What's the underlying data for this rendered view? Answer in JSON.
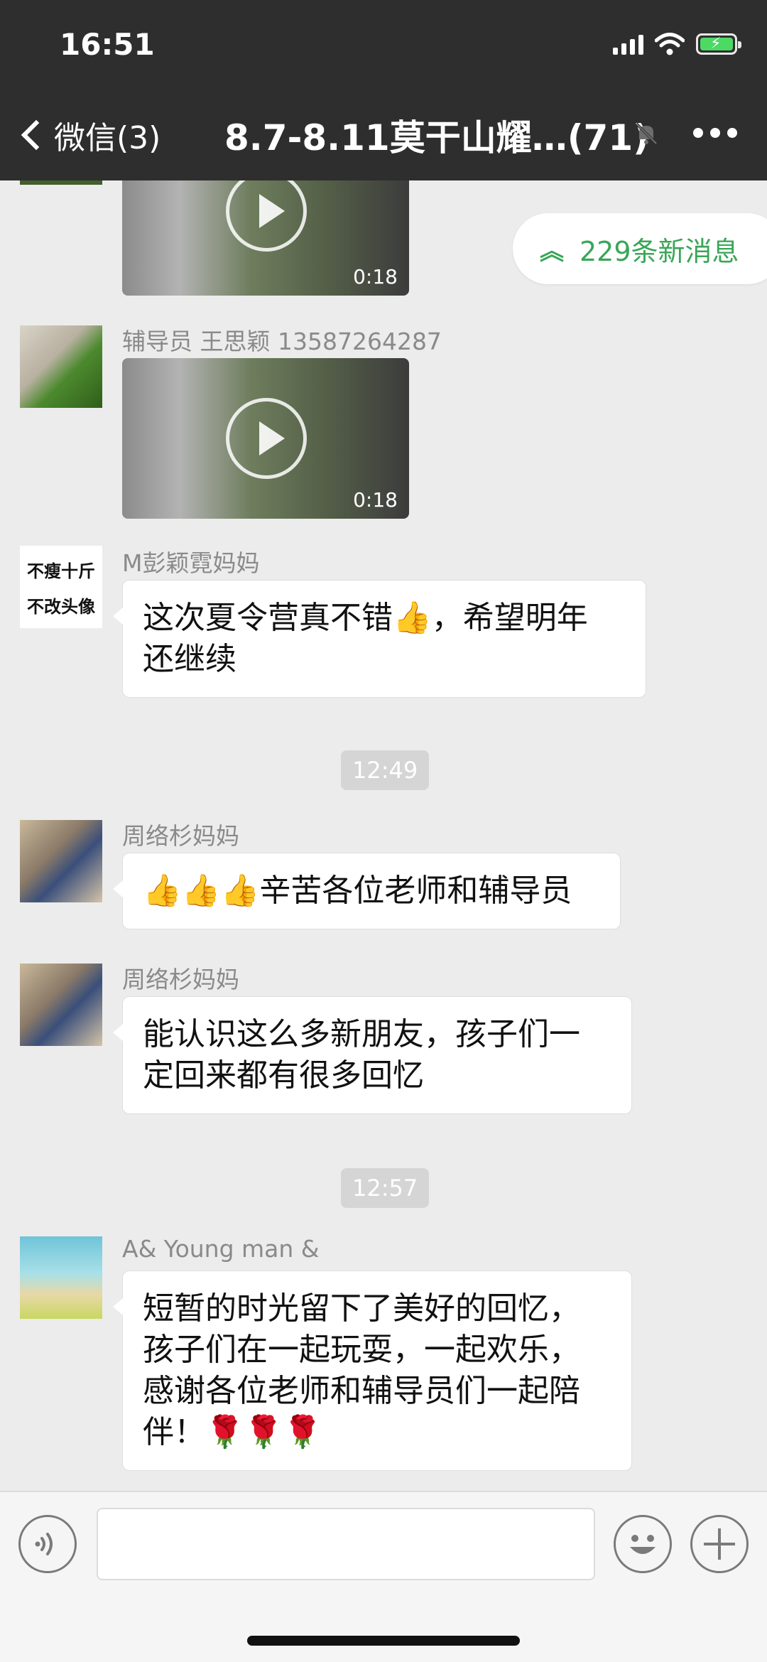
{
  "status_bar": {
    "time": "16:51"
  },
  "header": {
    "back_label": "微信(3)",
    "title": "8.7-8.11莫干山耀…(71)"
  },
  "new_messages_banner": "229条新消息",
  "messages": [
    {
      "type": "video",
      "duration": "0:18"
    },
    {
      "type": "video",
      "sender": "辅导员 王思颖 13587264287",
      "duration": "0:18"
    },
    {
      "type": "text",
      "sender": "M彭颖霓妈妈",
      "avatar_text_line1": "不瘦十斤",
      "avatar_text_line2": "不改头像",
      "lines": [
        "这次夏令营真不错👍，希望明年",
        "还继续"
      ]
    },
    {
      "type": "time",
      "text": "12:49"
    },
    {
      "type": "text",
      "sender": "周络杉妈妈",
      "lines": [
        "👍👍👍辛苦各位老师和辅导员"
      ]
    },
    {
      "type": "text",
      "sender": "周络杉妈妈",
      "lines": [
        "能认识这么多新朋友，孩子们一",
        "定回来都有很多回忆"
      ]
    },
    {
      "type": "time",
      "text": "12:57"
    },
    {
      "type": "text",
      "sender": "A&  Young   man  &",
      "lines": [
        "短暂的时光留下了美好的回忆，",
        "孩子们在一起玩耍，一起欢乐，",
        "感谢各位老师和辅导员们一起陪",
        "伴！🌹🌹🌹"
      ]
    }
  ],
  "icons": {
    "back": "chevron-left-icon",
    "mute": "mute-bell-icon",
    "more": "more-dots-icon",
    "voice": "voice-icon",
    "emoji": "emoji-icon",
    "add": "plus-icon"
  },
  "colors": {
    "header_bg": "#2e2e2e",
    "chat_bg": "#ececec",
    "accent_green": "#3aa657",
    "battery_green": "#4cd964"
  }
}
